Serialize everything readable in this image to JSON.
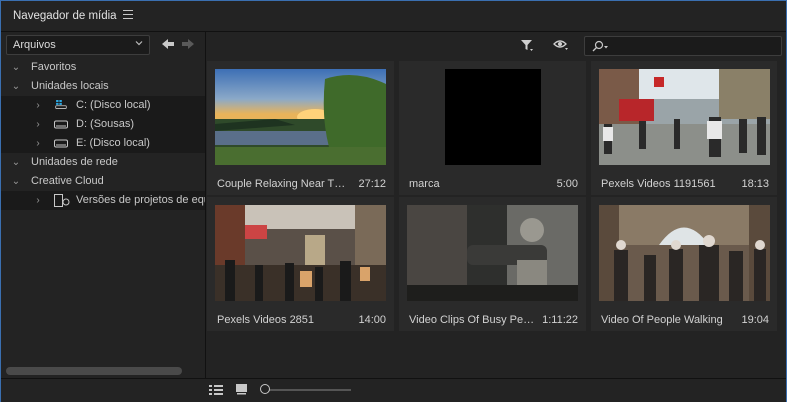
{
  "panel": {
    "title": "Navegador de mídia"
  },
  "left": {
    "dropdown_value": "Arquivos",
    "tree": [
      {
        "label": "Favoritos",
        "level": 0,
        "expanded": true
      },
      {
        "label": "Unidades locais",
        "level": 0,
        "expanded": true
      },
      {
        "label": "C: (Disco local)",
        "level": 1,
        "icon": "windows-drive-icon"
      },
      {
        "label": "D: (Sousas)",
        "level": 1,
        "icon": "drive-icon"
      },
      {
        "label": "E: (Disco local)",
        "level": 1,
        "icon": "drive-icon"
      },
      {
        "label": "Unidades de rede",
        "level": 0,
        "expanded": true
      },
      {
        "label": "Creative Cloud",
        "level": 0,
        "expanded": true
      },
      {
        "label": "Versões de projetos de equipe",
        "level": 1,
        "icon": "team-project-icon"
      }
    ]
  },
  "toolbar": {
    "filter_icon": "filter-icon",
    "view_icon": "eye-icon",
    "search_icon": "search-icon",
    "search_value": ""
  },
  "media": [
    {
      "name": "Couple Relaxing Near The ...",
      "duration": "27:12",
      "thumb": "sunset-pond"
    },
    {
      "name": "marca",
      "duration": "5:00",
      "thumb": "black"
    },
    {
      "name": "Pexels Videos 1191561",
      "duration": "18:13",
      "thumb": "street-crowd"
    },
    {
      "name": "Pexels Videos 2851",
      "duration": "14:00",
      "thumb": "market-alley"
    },
    {
      "name": "Video Clips Of Busy Peop...",
      "duration": "1:11:22",
      "thumb": "coffee-machine"
    },
    {
      "name": "Video Of People Walking",
      "duration": "19:04",
      "thumb": "arcade-walk"
    }
  ],
  "footer": {
    "list_view_icon": "list-view-icon",
    "icon_view_icon": "icon-view-icon",
    "zoom": 0.05
  },
  "colors": {
    "border_accent": "#3a6fb0",
    "panel_bg": "#232323",
    "card_bg": "#2a2a2a"
  }
}
